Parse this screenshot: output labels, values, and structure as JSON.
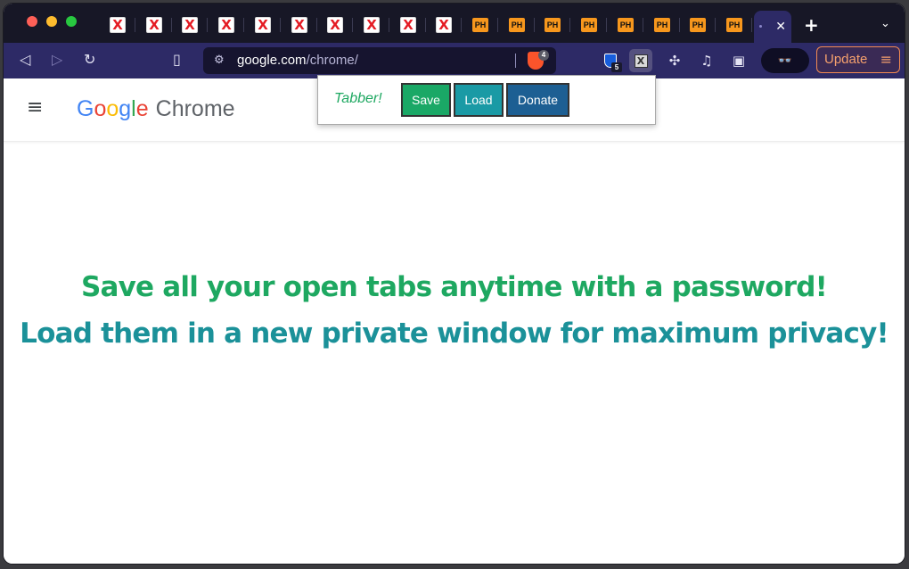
{
  "tabstrip": {
    "tabs": [
      {
        "favicon": "x-favicon",
        "glyph": "X"
      },
      {
        "favicon": "x-favicon",
        "glyph": "X"
      },
      {
        "favicon": "x-favicon",
        "glyph": "X"
      },
      {
        "favicon": "x-favicon",
        "glyph": "X"
      },
      {
        "favicon": "x-favicon",
        "glyph": "X"
      },
      {
        "favicon": "x-favicon",
        "glyph": "X"
      },
      {
        "favicon": "x-favicon",
        "glyph": "X"
      },
      {
        "favicon": "x-favicon",
        "glyph": "X"
      },
      {
        "favicon": "x-favicon",
        "glyph": "X"
      },
      {
        "favicon": "x-favicon",
        "glyph": "X"
      },
      {
        "favicon": "ph-favicon",
        "glyph": "PH"
      },
      {
        "favicon": "ph-favicon",
        "glyph": "PH"
      },
      {
        "favicon": "ph-favicon",
        "glyph": "PH"
      },
      {
        "favicon": "ph-favicon",
        "glyph": "PH"
      },
      {
        "favicon": "ph-favicon",
        "glyph": "PH"
      },
      {
        "favicon": "ph-favicon",
        "glyph": "PH"
      },
      {
        "favicon": "ph-favicon",
        "glyph": "PH"
      },
      {
        "favicon": "ph-favicon",
        "glyph": "PH"
      }
    ],
    "active_close_glyph": "✕",
    "new_tab_glyph": "+",
    "tab_search_glyph": "⌄"
  },
  "toolbar": {
    "back_glyph": "◁",
    "forward_glyph": "▷",
    "reload_glyph": "↻",
    "bookmark_glyph": "▯",
    "omnibox": {
      "tune_glyph": "⚙",
      "url_host": "google.com",
      "url_path": "/chrome/"
    },
    "brave_shield_count": "4",
    "bitwarden_badge": "5",
    "tabber_glyph": "X",
    "puzzle_glyph": "✣",
    "media_glyph": "♫",
    "sidebar_glyph": "▣",
    "wallet_glyph": "👓",
    "update_label": "Update",
    "update_menu_glyph": "≡"
  },
  "page": {
    "menu_glyph": "≡",
    "logo": {
      "letters": [
        "G",
        "o",
        "o",
        "g",
        "l",
        "e"
      ],
      "product": "Chrome"
    },
    "headline_1": "Save all your open tabs anytime with a password!",
    "headline_2": "Load them in a new private window for maximum privacy!"
  },
  "popup": {
    "title": "Tabber!",
    "save_label": "Save",
    "load_label": "Load",
    "donate_label": "Donate"
  },
  "colors": {
    "tabstrip_bg": "#171726",
    "toolbar_bg": "#2d2a66",
    "accent_green": "#1ea861",
    "accent_teal": "#1b9199",
    "donate_blue": "#1d5f93",
    "update_orange": "#f28a52"
  }
}
